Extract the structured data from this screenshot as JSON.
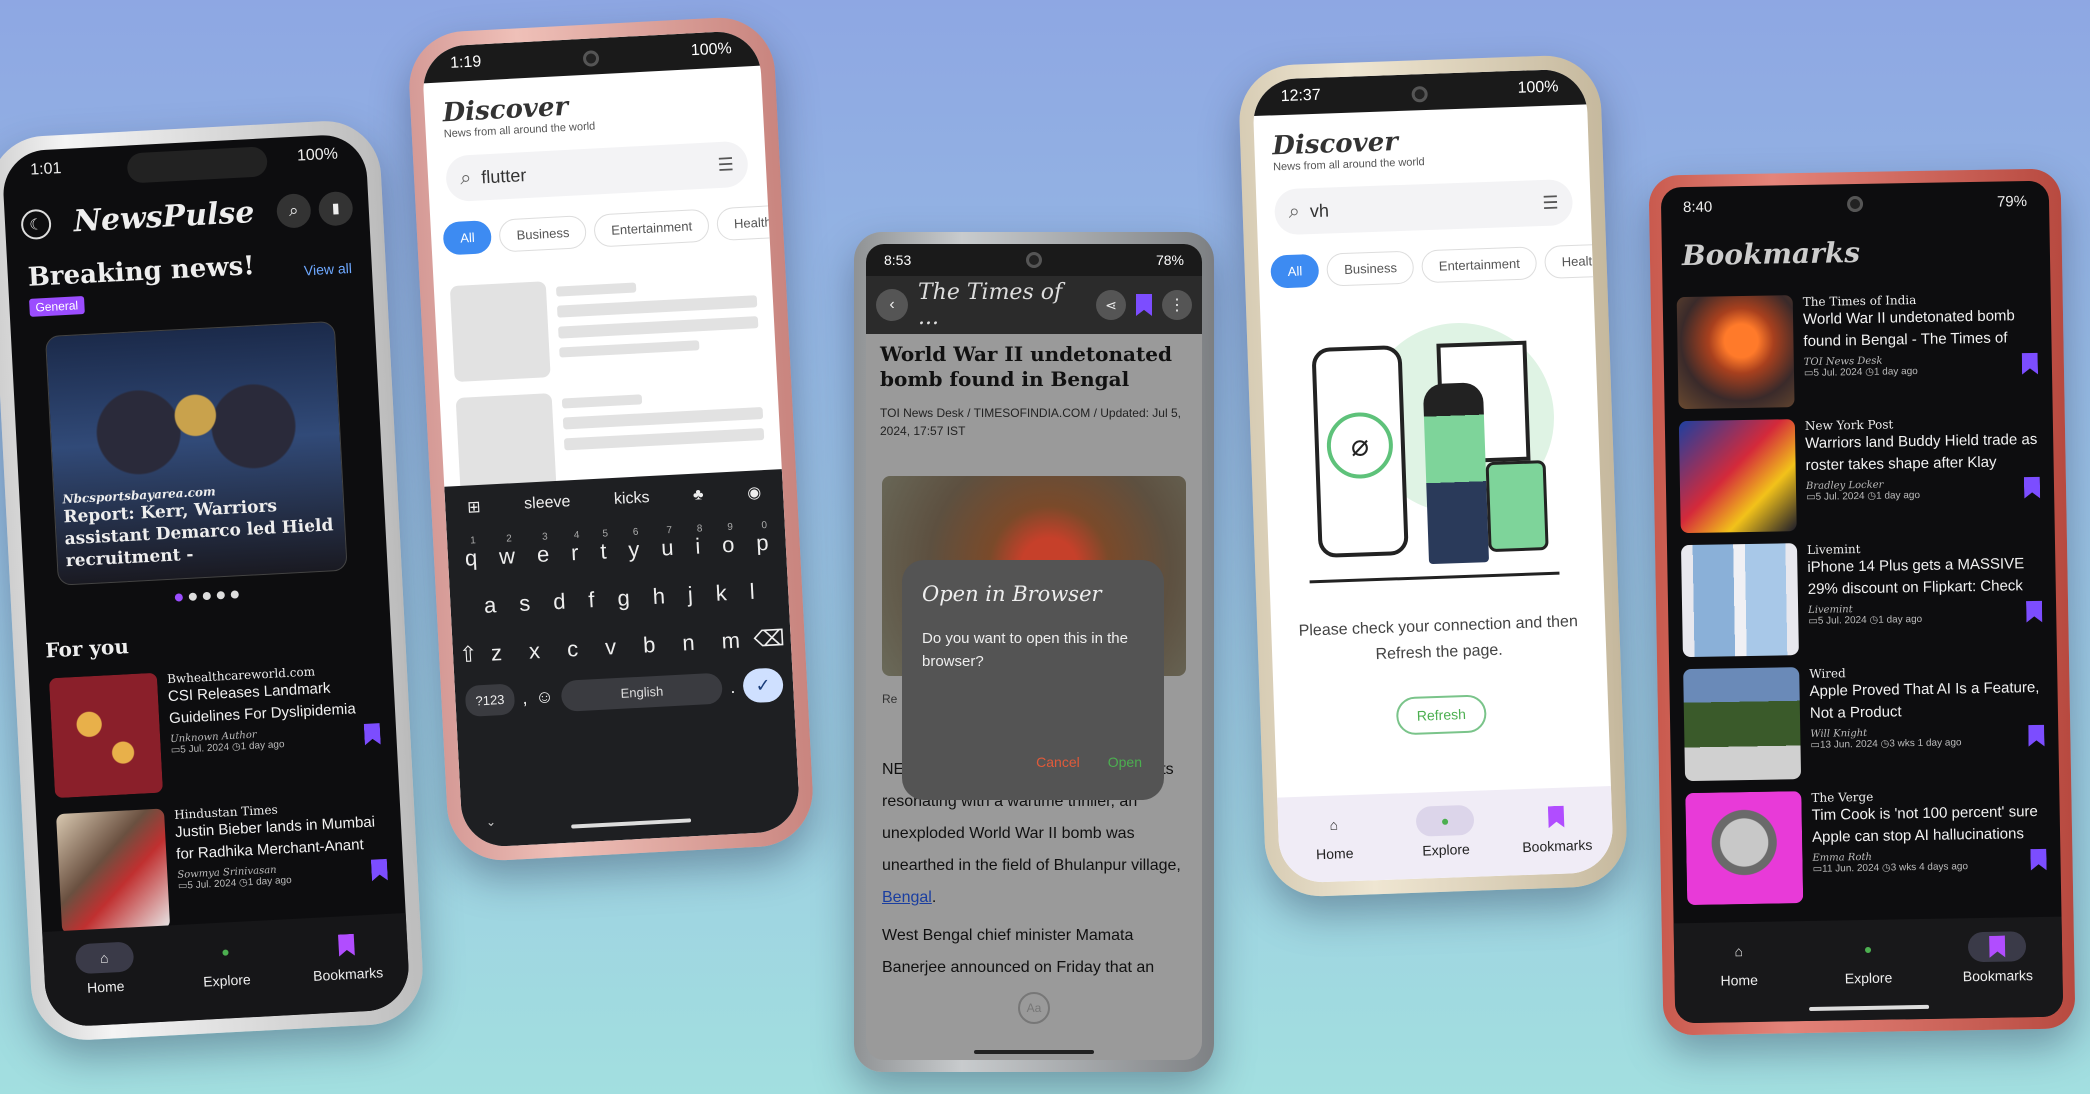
{
  "phone1": {
    "status": {
      "time": "1:01",
      "battery": "100%"
    },
    "app_title": "NewsPulse",
    "breaking_title": "Breaking news!",
    "view_all": "View all",
    "tag": "General",
    "featured": {
      "source": "Nbcsportsbayarea.com",
      "title": "Report: Kerr, Warriors assistant Demarco led Hield recruitment -"
    },
    "for_you": "For you",
    "articles": [
      {
        "source": "Bwhealthcareworld.com",
        "title": "CSI Releases Landmark Guidelines For Dyslipidemia",
        "author": "Unknown Author",
        "date": "5 Jul. 2024",
        "ago": "1 day ago"
      },
      {
        "source": "Hindustan Times",
        "title": "Justin Bieber lands in Mumbai for Radhika Merchant-Anant",
        "author": "Sowmya Srinivasan",
        "date": "5 Jul. 2024",
        "ago": "1 day ago"
      }
    ],
    "nav": {
      "home": "Home",
      "explore": "Explore",
      "bookmarks": "Bookmarks"
    }
  },
  "phone2": {
    "status": {
      "time": "1:19",
      "battery": "100%"
    },
    "title": "Discover",
    "subtitle": "News from all around the world",
    "search_value": "flutter",
    "chips": [
      "All",
      "Business",
      "Entertainment",
      "Health"
    ],
    "suggestions": [
      "sleeve",
      "kicks"
    ],
    "keyboard_rows": [
      [
        "q",
        "w",
        "e",
        "r",
        "t",
        "y",
        "u",
        "i",
        "o",
        "p"
      ],
      [
        "a",
        "s",
        "d",
        "f",
        "g",
        "h",
        "j",
        "k",
        "l"
      ],
      [
        "z",
        "x",
        "c",
        "v",
        "b",
        "n",
        "m"
      ]
    ],
    "number_hints": [
      "1",
      "2",
      "3",
      "4",
      "5",
      "6",
      "7",
      "8",
      "9",
      "0"
    ],
    "sym_key": "?123",
    "space_label": "English"
  },
  "phone3": {
    "status": {
      "time": "8:53",
      "battery": "78%"
    },
    "appbar_title": "The Times of ...",
    "headline": "World War II undetonated bomb found in Bengal",
    "byline": "TOI News Desk / TIMESOFINDIA.COM / Updated: Jul 5, 2024, 17:57 IST",
    "dialog": {
      "title": "Open in Browser",
      "message": "Do you want to open this in the browser?",
      "cancel": "Cancel",
      "open": "Open"
    },
    "body1": "NEW DELHI: In a dramatic turn of events resonating with a wartime thriller, an unexploded World War II bomb was unearthed in the field of Bhulanpur village,",
    "link": "Bengal",
    "body2": "West Bengal chief minister Mamata Banerjee announced on Friday that an",
    "caption_stub": "Re",
    "fab": "Aa"
  },
  "phone4": {
    "status": {
      "time": "12:37",
      "battery": "100%"
    },
    "title": "Discover",
    "subtitle": "News from all around the world",
    "search_value": "vh",
    "chips": [
      "All",
      "Business",
      "Entertainment",
      "Health"
    ],
    "message": "Please check your connection and then Refresh the page.",
    "refresh": "Refresh",
    "nav": {
      "home": "Home",
      "explore": "Explore",
      "bookmarks": "Bookmarks"
    }
  },
  "phone5": {
    "status": {
      "time": "8:40",
      "battery": "79%"
    },
    "title": "Bookmarks",
    "items": [
      {
        "source": "The Times of India",
        "title": "World War II undetonated bomb found in Bengal - The Times of",
        "author": "TOI News Desk",
        "date": "5 Jul. 2024",
        "ago": "1 day ago"
      },
      {
        "source": "New York Post",
        "title": "Warriors land Buddy Hield trade as roster takes shape after Klay",
        "author": "Bradley Locker",
        "date": "5 Jul. 2024",
        "ago": "1 day ago"
      },
      {
        "source": "Livemint",
        "title": "iPhone 14 Plus gets a MASSIVE 29% discount on Flipkart: Check",
        "author": "Livemint",
        "date": "5 Jul. 2024",
        "ago": "1 day ago"
      },
      {
        "source": "Wired",
        "title": "Apple Proved That AI Is a Feature, Not a Product",
        "author": "Will Knight",
        "date": "13 Jun. 2024",
        "ago": "3 wks 1 day ago"
      },
      {
        "source": "The Verge",
        "title": "Tim Cook is 'not 100 percent' sure Apple can stop AI hallucinations",
        "author": "Emma Roth",
        "date": "11 Jun. 2024",
        "ago": "3 wks 4 days ago"
      }
    ],
    "nav": {
      "home": "Home",
      "explore": "Explore",
      "bookmarks": "Bookmarks"
    }
  },
  "colors": {
    "accent": "#7c4dff",
    "chip_active": "#3d8bf2",
    "refresh_green": "#4caf50",
    "cancel_red": "#e05a3a"
  }
}
